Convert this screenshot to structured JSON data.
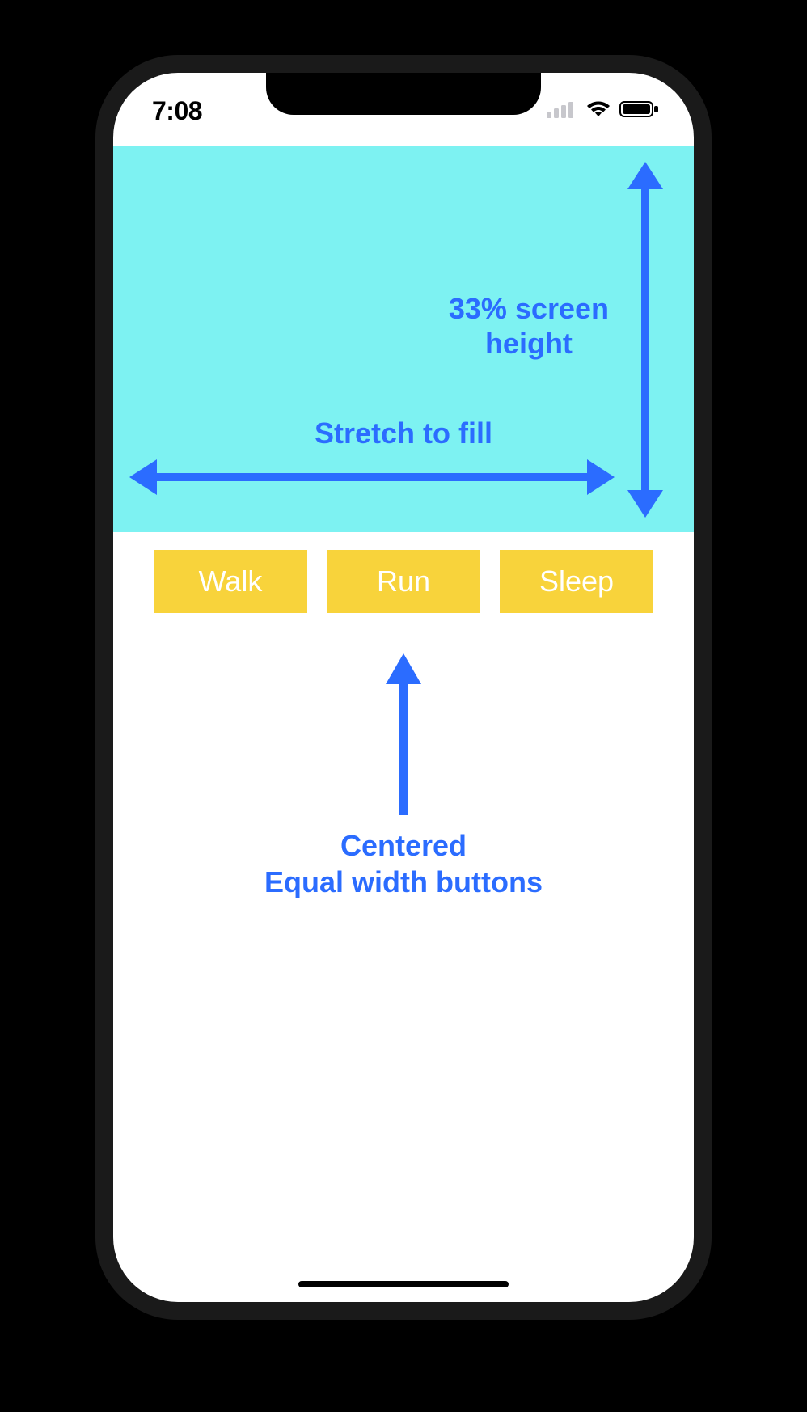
{
  "status_bar": {
    "time": "7:08"
  },
  "top_panel": {
    "height_label_line1": "33% screen",
    "height_label_line2": "height",
    "stretch_label": "Stretch to fill",
    "bg_color": "#7DF2F2"
  },
  "buttons": {
    "walk": "Walk",
    "run": "Run",
    "sleep": "Sleep"
  },
  "annotation_center": {
    "line1": "Centered",
    "line2": "Equal width buttons"
  },
  "colors": {
    "annotation": "#2B6CFF",
    "button_bg": "#F8D33B",
    "button_text": "#FFFFFF"
  }
}
